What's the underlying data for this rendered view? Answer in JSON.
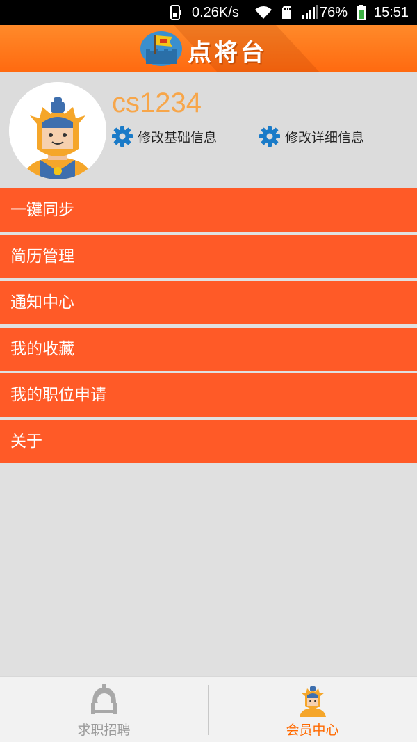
{
  "status_bar": {
    "network_speed": "0.26K/s",
    "battery_percent": "76%",
    "time": "15:51",
    "icons": [
      "sim-icon",
      "wifi-icon",
      "sd-card-icon",
      "signal-icon",
      "battery-icon"
    ]
  },
  "header": {
    "title": "点将台",
    "logo_icon": "flag-castle-icon",
    "accent_color": "#ff6a10"
  },
  "profile": {
    "username": "cs1234",
    "avatar_icon": "general-avatar-icon",
    "edit_basic_label": "修改基础信息",
    "edit_detail_label": "修改详细信息",
    "gear_color": "#1a7bc8",
    "username_color": "#f7a64a"
  },
  "menu": {
    "items": [
      {
        "label": "一键同步"
      },
      {
        "label": "简历管理"
      },
      {
        "label": "通知中心"
      },
      {
        "label": "我的收藏"
      },
      {
        "label": "我的职位申请"
      },
      {
        "label": "关于"
      }
    ],
    "item_color": "#ff5a27"
  },
  "bottom_nav": {
    "tabs": [
      {
        "label": "求职招聘",
        "icon": "helmet-icon",
        "active": false
      },
      {
        "label": "会员中心",
        "icon": "general-icon",
        "active": true
      }
    ],
    "active_color": "#ff6a00"
  }
}
